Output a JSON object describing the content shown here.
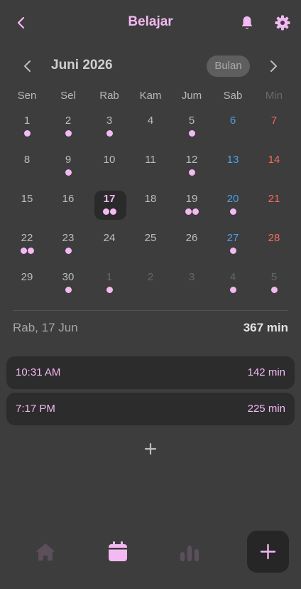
{
  "header": {
    "title": "Belajar",
    "icons": [
      "back-icon",
      "bell-icon",
      "gear-icon"
    ],
    "accent_color": "#f3b9f2"
  },
  "calendar": {
    "month_label": "Juni 2026",
    "view_mode_label": "Bulan",
    "weekdays": [
      "Sen",
      "Sel",
      "Rab",
      "Kam",
      "Jum",
      "Sab",
      "Min"
    ],
    "days": [
      {
        "label": "1",
        "dots": 1
      },
      {
        "label": "2",
        "dots": 1
      },
      {
        "label": "3",
        "dots": 1
      },
      {
        "label": "4",
        "dots": 0
      },
      {
        "label": "5",
        "dots": 1
      },
      {
        "label": "6",
        "dots": 0,
        "kind": "sat"
      },
      {
        "label": "7",
        "dots": 0,
        "kind": "sun"
      },
      {
        "label": "8",
        "dots": 0
      },
      {
        "label": "9",
        "dots": 1
      },
      {
        "label": "10",
        "dots": 0
      },
      {
        "label": "11",
        "dots": 0
      },
      {
        "label": "12",
        "dots": 1
      },
      {
        "label": "13",
        "dots": 0,
        "kind": "sat"
      },
      {
        "label": "14",
        "dots": 0,
        "kind": "sun"
      },
      {
        "label": "15",
        "dots": 0
      },
      {
        "label": "16",
        "dots": 0
      },
      {
        "label": "17",
        "dots": 2,
        "selected": true
      },
      {
        "label": "18",
        "dots": 0
      },
      {
        "label": "19",
        "dots": 2
      },
      {
        "label": "20",
        "dots": 1,
        "kind": "sat"
      },
      {
        "label": "21",
        "dots": 0,
        "kind": "sun"
      },
      {
        "label": "22",
        "dots": 2
      },
      {
        "label": "23",
        "dots": 1
      },
      {
        "label": "24",
        "dots": 0
      },
      {
        "label": "25",
        "dots": 0
      },
      {
        "label": "26",
        "dots": 0
      },
      {
        "label": "27",
        "dots": 1,
        "kind": "sat"
      },
      {
        "label": "28",
        "dots": 0,
        "kind": "sun"
      },
      {
        "label": "29",
        "dots": 0
      },
      {
        "label": "30",
        "dots": 1
      },
      {
        "label": "1",
        "dots": 1,
        "kind": "other"
      },
      {
        "label": "2",
        "dots": 0,
        "kind": "other"
      },
      {
        "label": "3",
        "dots": 0,
        "kind": "other"
      },
      {
        "label": "4",
        "dots": 1,
        "kind": "other"
      },
      {
        "label": "5",
        "dots": 1,
        "kind": "other"
      }
    ]
  },
  "summary": {
    "date": "Rab, 17 Jun",
    "total": "367 min"
  },
  "sessions": [
    {
      "time": "10:31 AM",
      "duration": "142 min"
    },
    {
      "time": "7:17 PM",
      "duration": "225 min"
    }
  ],
  "bottom_nav": {
    "items": [
      "home-icon",
      "calendar-icon",
      "stats-icon"
    ],
    "active": "calendar-icon",
    "fab_icon": "plus-icon"
  },
  "colors": {
    "background": "#3d3d3d",
    "saturday": "#4e9ee8",
    "sunday": "#f06b5f",
    "dot": "#f3b9f2"
  }
}
